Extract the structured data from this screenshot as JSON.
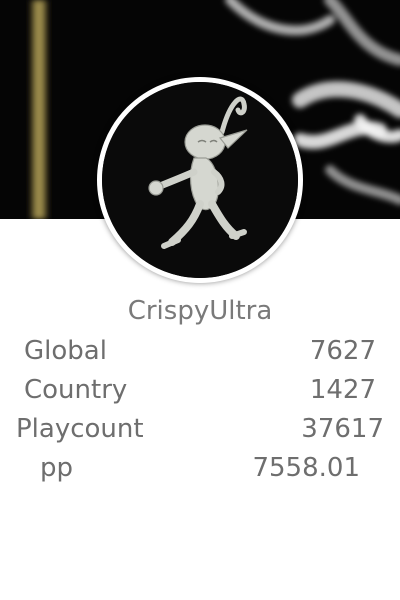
{
  "profile": {
    "username": "CrispyUltra"
  },
  "stats": {
    "global_label": "Global",
    "global_value": "7627",
    "country_label": "Country",
    "country_value": "1427",
    "playcount_label": "Playcount",
    "playcount_value": "37617",
    "pp_label": "pp",
    "pp_value": "7558.01"
  },
  "icons": {
    "avatar": "creature-avatar-icon",
    "banner": "dark-blurred-banner"
  },
  "colors": {
    "banner_bg": "#050505",
    "text": "#6e6e6e",
    "ring": "#ffffff"
  }
}
